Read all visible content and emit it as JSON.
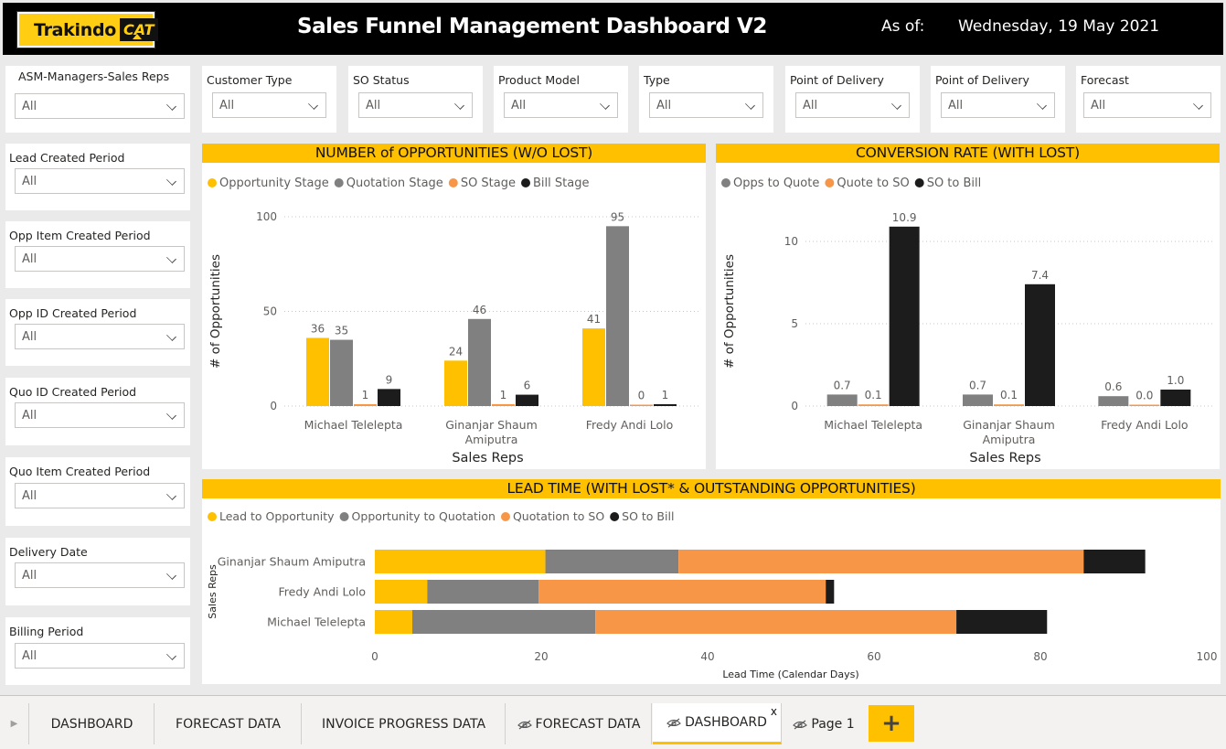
{
  "header": {
    "logo_name": "Trakindo",
    "logo_mark": "CAT",
    "title": "Sales Funnel Management Dashboard V2",
    "asof_label": "As of:",
    "asof_date": "Wednesday, 19 May 2021"
  },
  "top_slicers": [
    {
      "label": "Customer Type",
      "value": "All"
    },
    {
      "label": "SO Status",
      "value": "All"
    },
    {
      "label": "Product Model",
      "value": "All"
    },
    {
      "label": "Type",
      "value": "All"
    },
    {
      "label": "Point of Delivery",
      "value": "All"
    },
    {
      "label": "Point of Delivery",
      "value": "All"
    },
    {
      "label": "Forecast",
      "value": "All"
    }
  ],
  "side_slicers": [
    {
      "label": "ASM-Managers-Sales Reps",
      "value": "All"
    },
    {
      "label": "Lead Created Period",
      "value": "All"
    },
    {
      "label": "Opp Item Created Period",
      "value": "All"
    },
    {
      "label": "Opp ID Created Period",
      "value": "All"
    },
    {
      "label": "Quo ID Created Period",
      "value": "All"
    },
    {
      "label": "Quo Item Created Period",
      "value": "All"
    },
    {
      "label": "Delivery Date",
      "value": "All"
    },
    {
      "label": "Billing Period",
      "value": "All"
    }
  ],
  "colors": {
    "yellow": "#FFC000",
    "gray": "#808080",
    "orange": "#F79646",
    "black": "#1c1c1c"
  },
  "tabs": [
    {
      "label": "DASHBOARD",
      "hidden": false,
      "active": false
    },
    {
      "label": "FORECAST DATA",
      "hidden": false,
      "active": false
    },
    {
      "label": "INVOICE PROGRESS DATA",
      "hidden": false,
      "active": false
    },
    {
      "label": "FORECAST DATA",
      "hidden": true,
      "active": false
    },
    {
      "label": "DASHBOARD",
      "hidden": true,
      "active": true
    },
    {
      "label": "Page 1",
      "hidden": true,
      "active": false
    }
  ],
  "tab_close": "x",
  "add_page": "+",
  "chart_data": [
    {
      "type": "bar",
      "title": "NUMBER of OPPORTUNITIES (W/O LOST)",
      "categories": [
        [
          "Michael Telelepta"
        ],
        [
          "Ginanjar Shaum",
          "Amiputra"
        ],
        [
          "Fredy Andi Lolo"
        ]
      ],
      "series": [
        {
          "name": "Opportunity Stage",
          "color": "#FFC000",
          "values": [
            36,
            24,
            41
          ],
          "labels": [
            "36",
            "24",
            "41"
          ]
        },
        {
          "name": "Quotation Stage",
          "color": "#808080",
          "values": [
            35,
            46,
            95
          ],
          "labels": [
            "35",
            "46",
            "95"
          ]
        },
        {
          "name": "SO Stage",
          "color": "#F79646",
          "values": [
            1,
            1,
            0
          ],
          "labels": [
            "1",
            "1",
            "0"
          ]
        },
        {
          "name": "Bill Stage",
          "color": "#1c1c1c",
          "values": [
            9,
            6,
            1
          ],
          "labels": [
            "9",
            "6",
            "1"
          ]
        }
      ],
      "xlabel": "Sales Reps",
      "ylabel": "# of Opportunities",
      "ylim": [
        0,
        100
      ],
      "yticks": [
        0,
        50,
        100
      ],
      "grid": true,
      "legend": "top-left"
    },
    {
      "type": "bar",
      "title": "CONVERSION RATE (WITH LOST)",
      "categories": [
        [
          "Michael Telelepta"
        ],
        [
          "Ginanjar Shaum",
          "Amiputra"
        ],
        [
          "Fredy Andi Lolo"
        ]
      ],
      "series": [
        {
          "name": "Opps to Quote",
          "color": "#808080",
          "values": [
            0.7,
            0.7,
            0.6
          ],
          "labels": [
            "0.7",
            "0.7",
            "0.6"
          ]
        },
        {
          "name": "Quote to SO",
          "color": "#F79646",
          "values": [
            0.1,
            0.1,
            0.0
          ],
          "labels": [
            "0.1",
            "0.1",
            "0.0"
          ]
        },
        {
          "name": "SO to Bill",
          "color": "#1c1c1c",
          "values": [
            10.9,
            7.4,
            1.0
          ],
          "labels": [
            "10.9",
            "7.4",
            "1.0"
          ]
        }
      ],
      "xlabel": "Sales Reps",
      "ylabel": "# of Opportunities",
      "ylim": [
        0,
        11.5
      ],
      "yticks": [
        0,
        5,
        10
      ],
      "grid": true,
      "legend": "top-left"
    },
    {
      "type": "bar",
      "orientation": "horizontal-stacked",
      "title": "LEAD TIME (WITH LOST* & OUTSTANDING OPPORTUNITIES)",
      "categories": [
        "Ginanjar Shaum Amiputra",
        "Fredy Andi Lolo",
        "Michael Telelepta"
      ],
      "series": [
        {
          "name": "Lead to Opportunity",
          "color": "#FFC000",
          "values": [
            20.5,
            6.3,
            4.5
          ]
        },
        {
          "name": "Opportunity to Quotation",
          "color": "#808080",
          "values": [
            16.0,
            13.4,
            22.0
          ]
        },
        {
          "name": "Quotation to SO",
          "color": "#F79646",
          "values": [
            48.7,
            34.5,
            43.4
          ]
        },
        {
          "name": "SO to Bill",
          "color": "#1c1c1c",
          "values": [
            7.4,
            1.0,
            10.9
          ]
        }
      ],
      "xlabel": "Lead Time (Calendar Days)",
      "ylabel": "Sales Reps",
      "xlim": [
        0,
        100
      ],
      "xticks": [
        0,
        20,
        40,
        60,
        80,
        100
      ],
      "grid": false,
      "legend": "top-left"
    }
  ]
}
